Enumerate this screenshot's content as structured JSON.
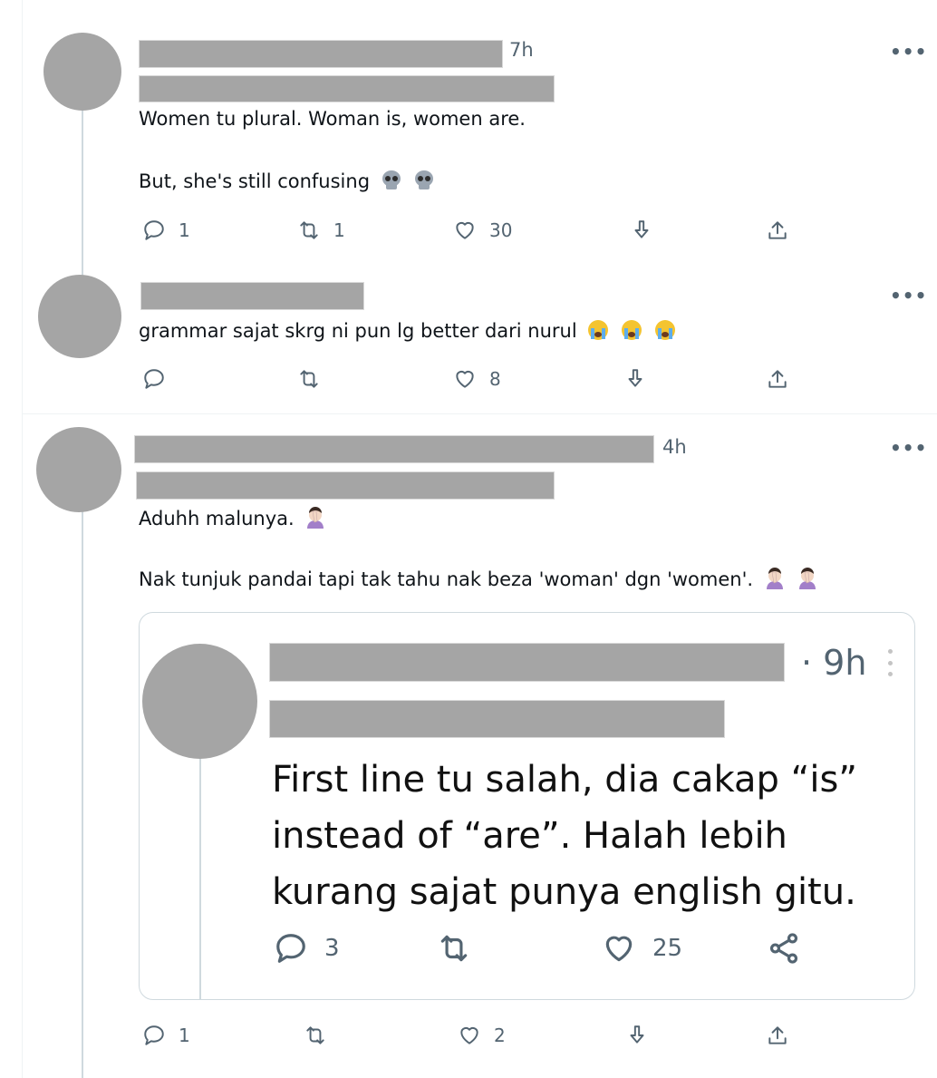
{
  "tweets": [
    {
      "time": "7h",
      "text_lines": [
        "Women tu plural. Woman is, women are.",
        "But, she's still confusing"
      ],
      "emoji": "skull-icon",
      "actions": {
        "replies": "1",
        "retweets": "1",
        "likes": "30"
      }
    },
    {
      "time": "",
      "text_lines": [
        "grammar sajat skrg ni pun lg better dari nurul"
      ],
      "emoji": "loudly-crying-face-icon",
      "actions": {
        "replies": "",
        "retweets": "",
        "likes": "8"
      }
    },
    {
      "time": "4h",
      "text_lines": [
        "Aduhh malunya.",
        "Nak tunjuk pandai tapi tak tahu nak beza 'woman' dgn 'women'."
      ],
      "emoji": "face-palm-icon",
      "actions": {
        "replies": "1",
        "retweets": "",
        "likes": "2"
      },
      "quote": {
        "time": "· 9h",
        "text_lines": [
          "First line tu salah, dia cakap “is”",
          "instead of “are”. Halah lebih",
          "kurang sajat punya english gitu."
        ],
        "actions": {
          "replies": "3",
          "retweets": "",
          "likes": "25"
        }
      }
    }
  ],
  "more_label": "•••",
  "colors": {
    "redaction": "#a5a5a5",
    "muted": "#536471",
    "border": "#cfd9de"
  }
}
